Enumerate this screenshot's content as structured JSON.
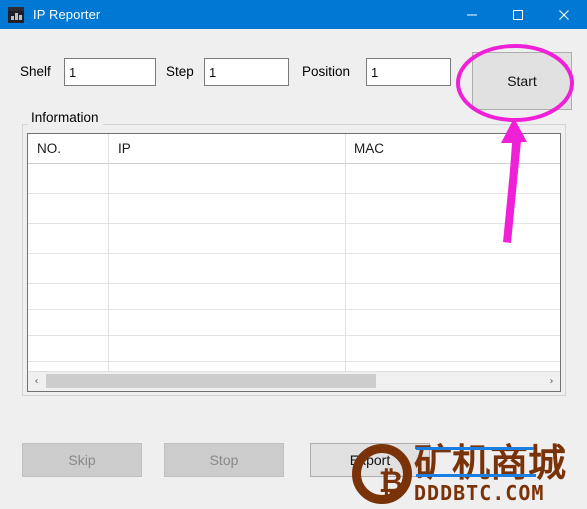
{
  "window": {
    "title": "IP Reporter",
    "icon": "app-icon",
    "titlebar_color": "#0078d4",
    "background_color": "#efefef",
    "controls": {
      "minimize": "minimize-icon",
      "maximize": "maximize-icon",
      "close": "close-icon"
    }
  },
  "form": {
    "shelf": {
      "label": "Shelf",
      "value": "1",
      "placeholder": ""
    },
    "step": {
      "label": "Step",
      "value": "1",
      "placeholder": ""
    },
    "position": {
      "label": "Position",
      "value": "1",
      "placeholder": ""
    },
    "start_button": {
      "label": "Start",
      "enabled": true
    }
  },
  "information": {
    "legend": "Information",
    "columns": [
      "NO.",
      "IP",
      "MAC"
    ],
    "rows": [],
    "row_count_visible": 8,
    "scrollbar": {
      "left_arrow": "‹",
      "right_arrow": "›",
      "thumb_fraction": "0.62"
    }
  },
  "actions": [
    {
      "label": "Skip",
      "enabled": false
    },
    {
      "label": "Stop",
      "enabled": false
    },
    {
      "label": "Export",
      "enabled": true
    }
  ],
  "annotation": {
    "color": "#f020d8",
    "shapes": [
      "ellipse-around-start-button",
      "arrow-pointing-up-to-start-button"
    ]
  },
  "watermark": {
    "logo": "bitcoin-logo",
    "symbol": "₿",
    "brand_cn": "矿机商城",
    "site": "DDDBTC.COM",
    "color": "#7a3208",
    "accent_color": "#1a7fe0"
  }
}
